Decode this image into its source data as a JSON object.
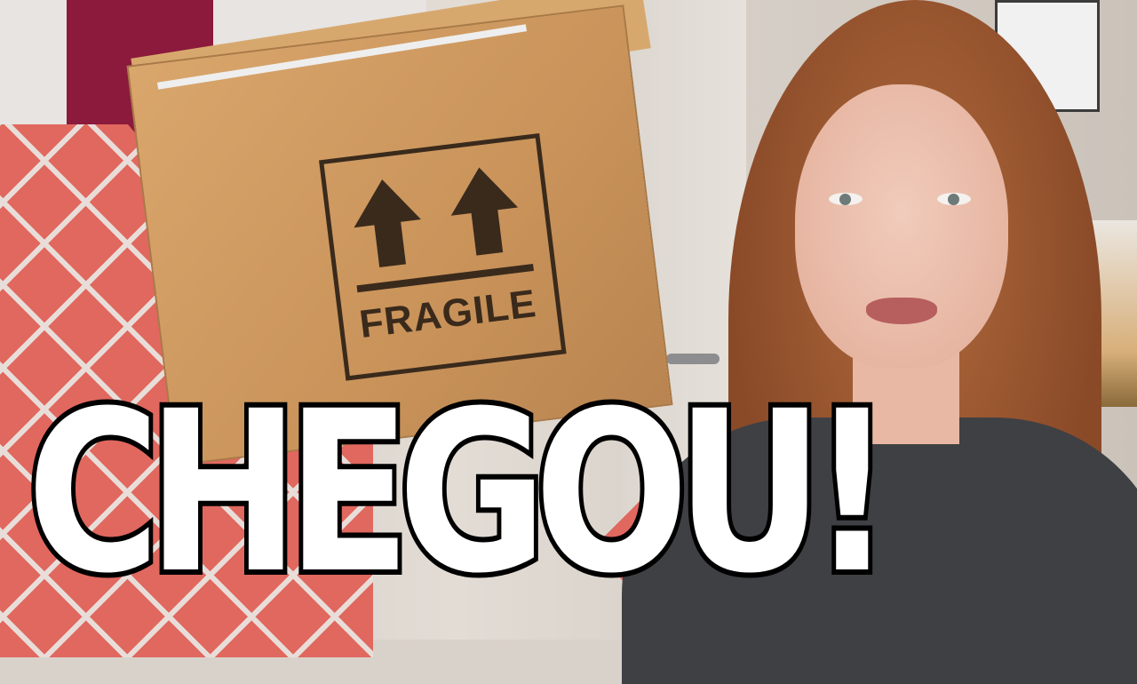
{
  "thumbnail": {
    "headline": "CHEGOU!",
    "box_label": "FRAGILE",
    "colors": {
      "headline_fill": "#ffffff",
      "headline_stroke": "#000000",
      "pattern": "#e0685f",
      "box": "#c9935a"
    }
  }
}
